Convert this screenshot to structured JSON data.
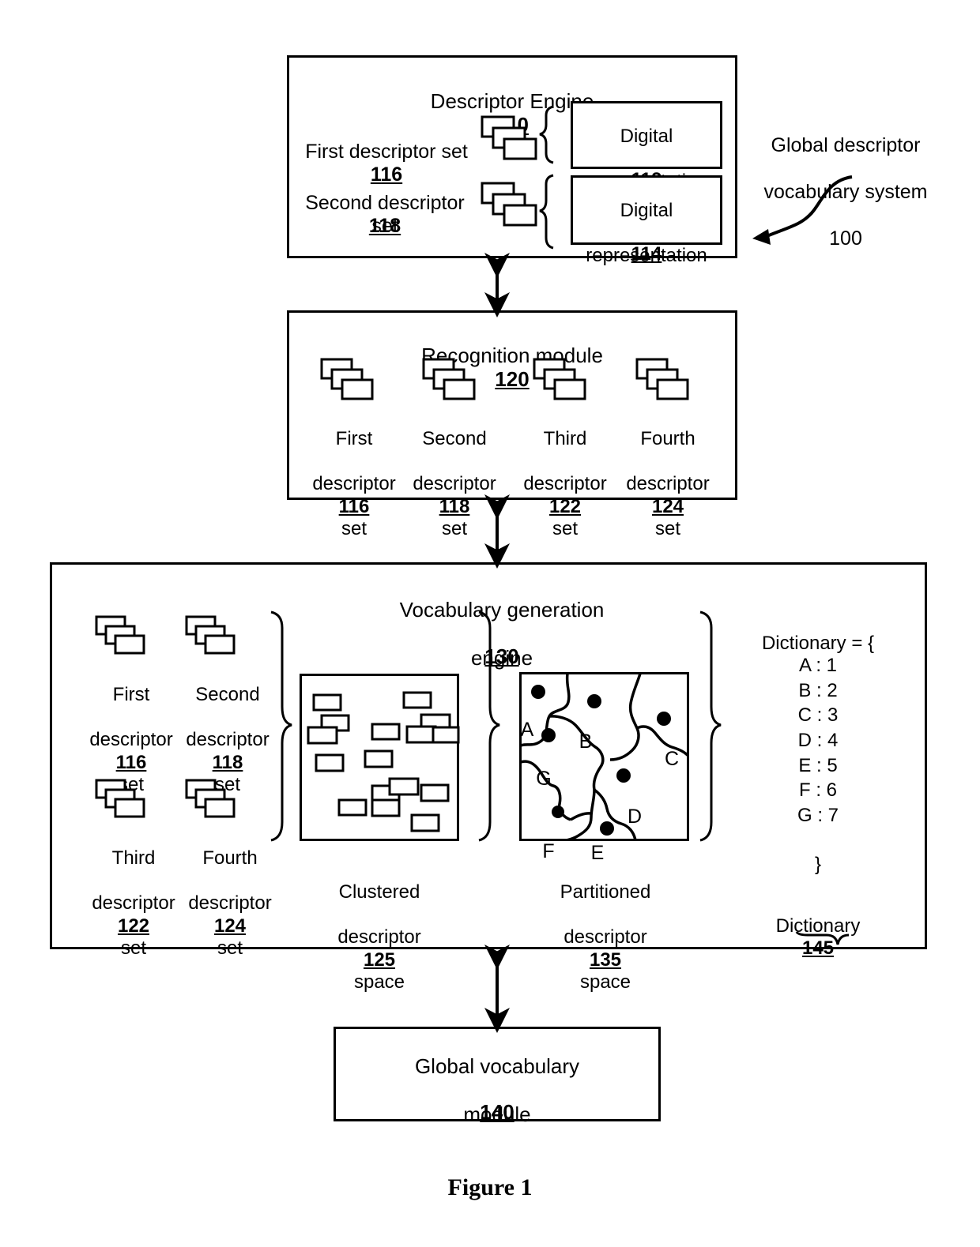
{
  "figure": {
    "caption": "Figure 1"
  },
  "system_callout": {
    "line1": "Global descriptor",
    "line2": "vocabulary system",
    "number": "100"
  },
  "descriptor_engine": {
    "title": "Descriptor Engine",
    "number": "110",
    "first_set": {
      "label": "First descriptor set",
      "number": "116"
    },
    "second_set": {
      "label": "Second descriptor set",
      "number": "118"
    },
    "digital_1": {
      "line1": "Digital",
      "line2": "representation",
      "number": "112"
    },
    "digital_2": {
      "line1": "Digital",
      "line2": "representation",
      "number": "114"
    }
  },
  "recognition_module": {
    "title": "Recognition module",
    "number": "120",
    "sets": [
      {
        "line1": "First",
        "line2": "descriptor",
        "line3": "set",
        "number": "116"
      },
      {
        "line1": "Second",
        "line2": "descriptor",
        "line3": "set",
        "number": "118"
      },
      {
        "line1": "Third",
        "line2": "descriptor",
        "line3": "set",
        "number": "122"
      },
      {
        "line1": "Fourth",
        "line2": "descriptor",
        "line3": "set",
        "number": "124"
      }
    ]
  },
  "vocabulary_generation_engine": {
    "title_line1": "Vocabulary generation",
    "title_line2": "engine",
    "number": "130",
    "sets": [
      {
        "line1": "First",
        "line2": "descriptor",
        "line3": "set",
        "number": "116"
      },
      {
        "line1": "Second",
        "line2": "descriptor",
        "line3": "set",
        "number": "118"
      },
      {
        "line1": "Third",
        "line2": "descriptor",
        "line3": "set",
        "number": "122"
      },
      {
        "line1": "Fourth",
        "line2": "descriptor",
        "line3": "set",
        "number": "124"
      }
    ],
    "clustered_space": {
      "line1": "Clustered",
      "line2": "descriptor",
      "line3": "space",
      "number": "125"
    },
    "partitioned_space": {
      "line1": "Partitioned",
      "line2": "descriptor",
      "line3": "space",
      "number": "135",
      "region_labels": [
        "A",
        "B",
        "C",
        "D",
        "E",
        "F",
        "G"
      ]
    },
    "dictionary": {
      "header": "Dictionary = {",
      "entries": [
        "A : 1",
        "B : 2",
        "C : 3",
        "D : 4",
        "E : 5",
        "F : 6",
        "G : 7"
      ],
      "closer": "}",
      "caption": "Dictionary",
      "number": "145"
    }
  },
  "global_vocabulary_module": {
    "line1": "Global vocabulary",
    "line2": "module",
    "number": "140"
  },
  "colors": {
    "ink": "#000000",
    "paper": "#ffffff"
  }
}
